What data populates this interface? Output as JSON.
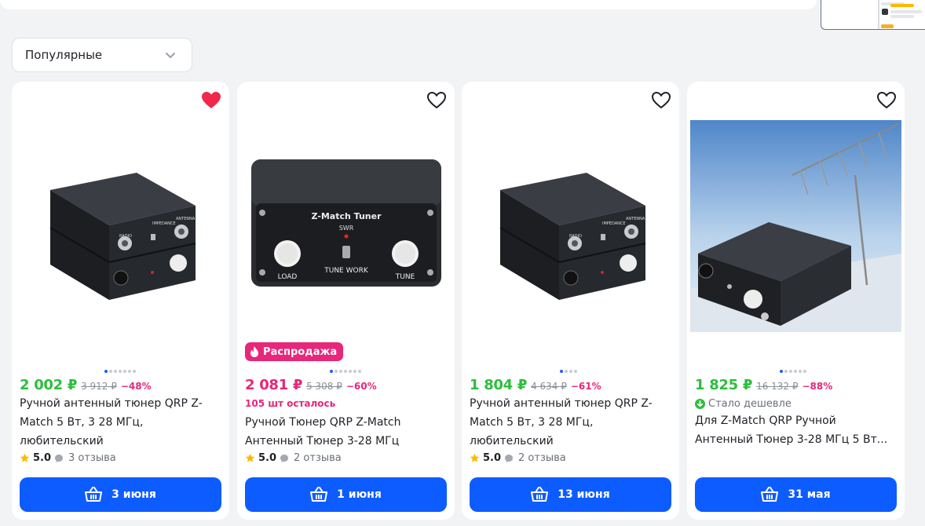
{
  "sort": {
    "selected": "Популярные"
  },
  "cards": [
    {
      "favorite": true,
      "price": "2 002 ₽",
      "old_price": "3 912 ₽",
      "discount": "−48%",
      "title": "Ручной антенный тюнер QRP Z-Match 5 Вт, 3 28 МГц, любительский",
      "rating": "5.0",
      "reviews": "3 отзыва",
      "delivery": "3 июня",
      "image_slides": 7,
      "image_active": 1
    },
    {
      "favorite": false,
      "badge": "Распродажа",
      "price": "2 081 ₽",
      "old_price": "5 308 ₽",
      "discount": "−60%",
      "stock": "105 шт осталось",
      "title": "Ручной Тюнер QRP Z-Match Антенный Тюнер 3-28 МГц",
      "rating": "5.0",
      "reviews": "2 отзыва",
      "delivery": "1 июня",
      "image_slides": 7,
      "image_active": 1,
      "panel": {
        "heading": "Z-Match Tuner",
        "swr": "SWR",
        "load": "LOAD",
        "tune": "TUNE",
        "brand": "TUNE WORK"
      }
    },
    {
      "favorite": false,
      "price": "1 804 ₽",
      "old_price": "4 634 ₽",
      "discount": "−61%",
      "title": "Ручной антенный тюнер QRP Z-Match 5 Вт, 3 28 МГц, любительский",
      "rating": "5.0",
      "reviews": "2 отзыва",
      "delivery": "13 июня",
      "image_slides": 4,
      "image_active": 1
    },
    {
      "favorite": false,
      "price": "1 825 ₽",
      "old_price": "16 132 ₽",
      "discount": "−88%",
      "cheaper_note": "Стало дешевле",
      "title": "Для Z-Match QRP Ручной Антенный Тюнер 3-28 МГц 5 Вт...",
      "delivery": "31 мая",
      "image_slides": 6,
      "image_active": 1
    }
  ],
  "colors": {
    "accent": "#0d5cff",
    "price_green": "#2bbf3c",
    "sale_pink": "#e8267a",
    "favorite_red": "#f0284a"
  }
}
